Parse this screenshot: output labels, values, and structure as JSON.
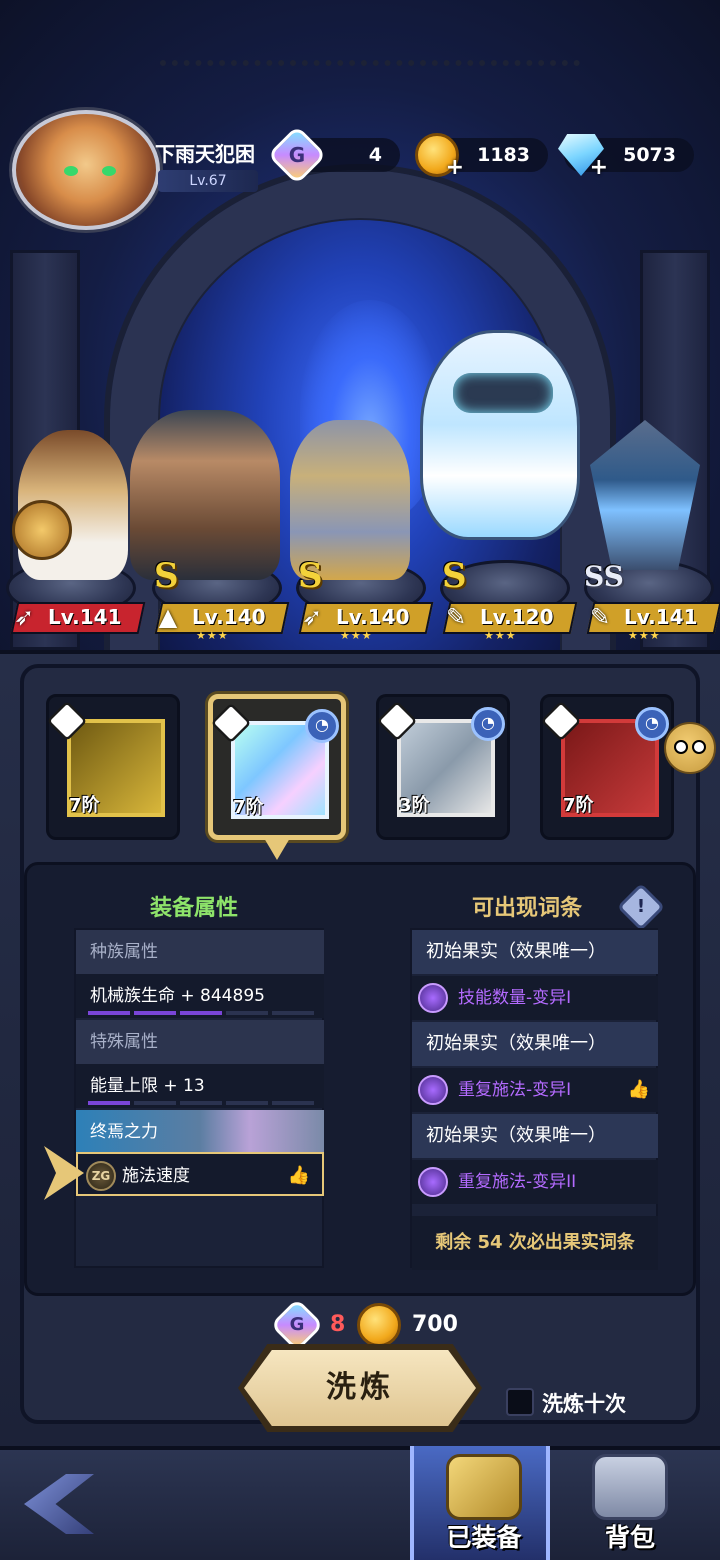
{
  "player": {
    "name": "下雨天犯困",
    "level": "Lv.67"
  },
  "resources": [
    {
      "icon": "g-token-icon",
      "value": "4"
    },
    {
      "icon": "gold-coin-icon",
      "value": "1183"
    },
    {
      "icon": "diamond-icon",
      "value": "5073"
    }
  ],
  "heroes": [
    {
      "rank": "",
      "level": "Lv.141",
      "class_icon": "wing-class-icon",
      "bar_color": "#c8242e"
    },
    {
      "rank": "S",
      "level": "Lv.140",
      "class_icon": "shield-class-icon",
      "bar_color": "#d0a028"
    },
    {
      "rank": "S",
      "level": "Lv.140",
      "class_icon": "wing-class-icon",
      "bar_color": "#d0a028"
    },
    {
      "rank": "S",
      "level": "Lv.120",
      "class_icon": "wrench-class-icon",
      "bar_color": "#d0a028"
    },
    {
      "rank": "SS",
      "level": "Lv.141",
      "class_icon": "wrench-class-icon",
      "bar_color": "#d0a028"
    }
  ],
  "equipment_slots": [
    {
      "name": "sword",
      "tier": "7阶",
      "locked": false,
      "frame_color": "#e2c24a"
    },
    {
      "name": "armor",
      "tier": "7阶",
      "locked": true,
      "frame_color": "#8fd8ff"
    },
    {
      "name": "pants",
      "tier": "3阶",
      "locked": true,
      "frame_color": "#e8e8e8"
    },
    {
      "name": "amulet",
      "tier": "7阶",
      "locked": true,
      "frame_color": "#d23a3a"
    }
  ],
  "equip_attrs": {
    "title": "装备属性",
    "race_header": "种族属性",
    "race_value": "机械族生命 + 844895",
    "special_header": "特殊属性",
    "special_value": "能量上限 + 13",
    "ultimate_header": "终焉之力",
    "ultimate_value": "施法速度",
    "ultimate_badge": "ZG"
  },
  "possible_entries": {
    "title": "可出现词条",
    "info_label": "!",
    "rows": [
      {
        "type": "init",
        "text": "初始果实（效果唯一）"
      },
      {
        "type": "perk",
        "text": "技能数量-变异I",
        "liked": false
      },
      {
        "type": "init",
        "text": "初始果实（效果唯一）"
      },
      {
        "type": "perk",
        "text": "重复施法-变异I",
        "liked": true
      },
      {
        "type": "init",
        "text": "初始果实（效果唯一）"
      },
      {
        "type": "perk",
        "text": "重复施法-变异II",
        "liked": false
      }
    ],
    "remaining_text": "剩余  54  次必出果实词条"
  },
  "cost": {
    "tokens": "8",
    "gold": "700"
  },
  "wash_button": "洗炼",
  "wash_ten_label": "洗炼十次",
  "nav": {
    "equipped": "已装备",
    "bag": "背包"
  }
}
